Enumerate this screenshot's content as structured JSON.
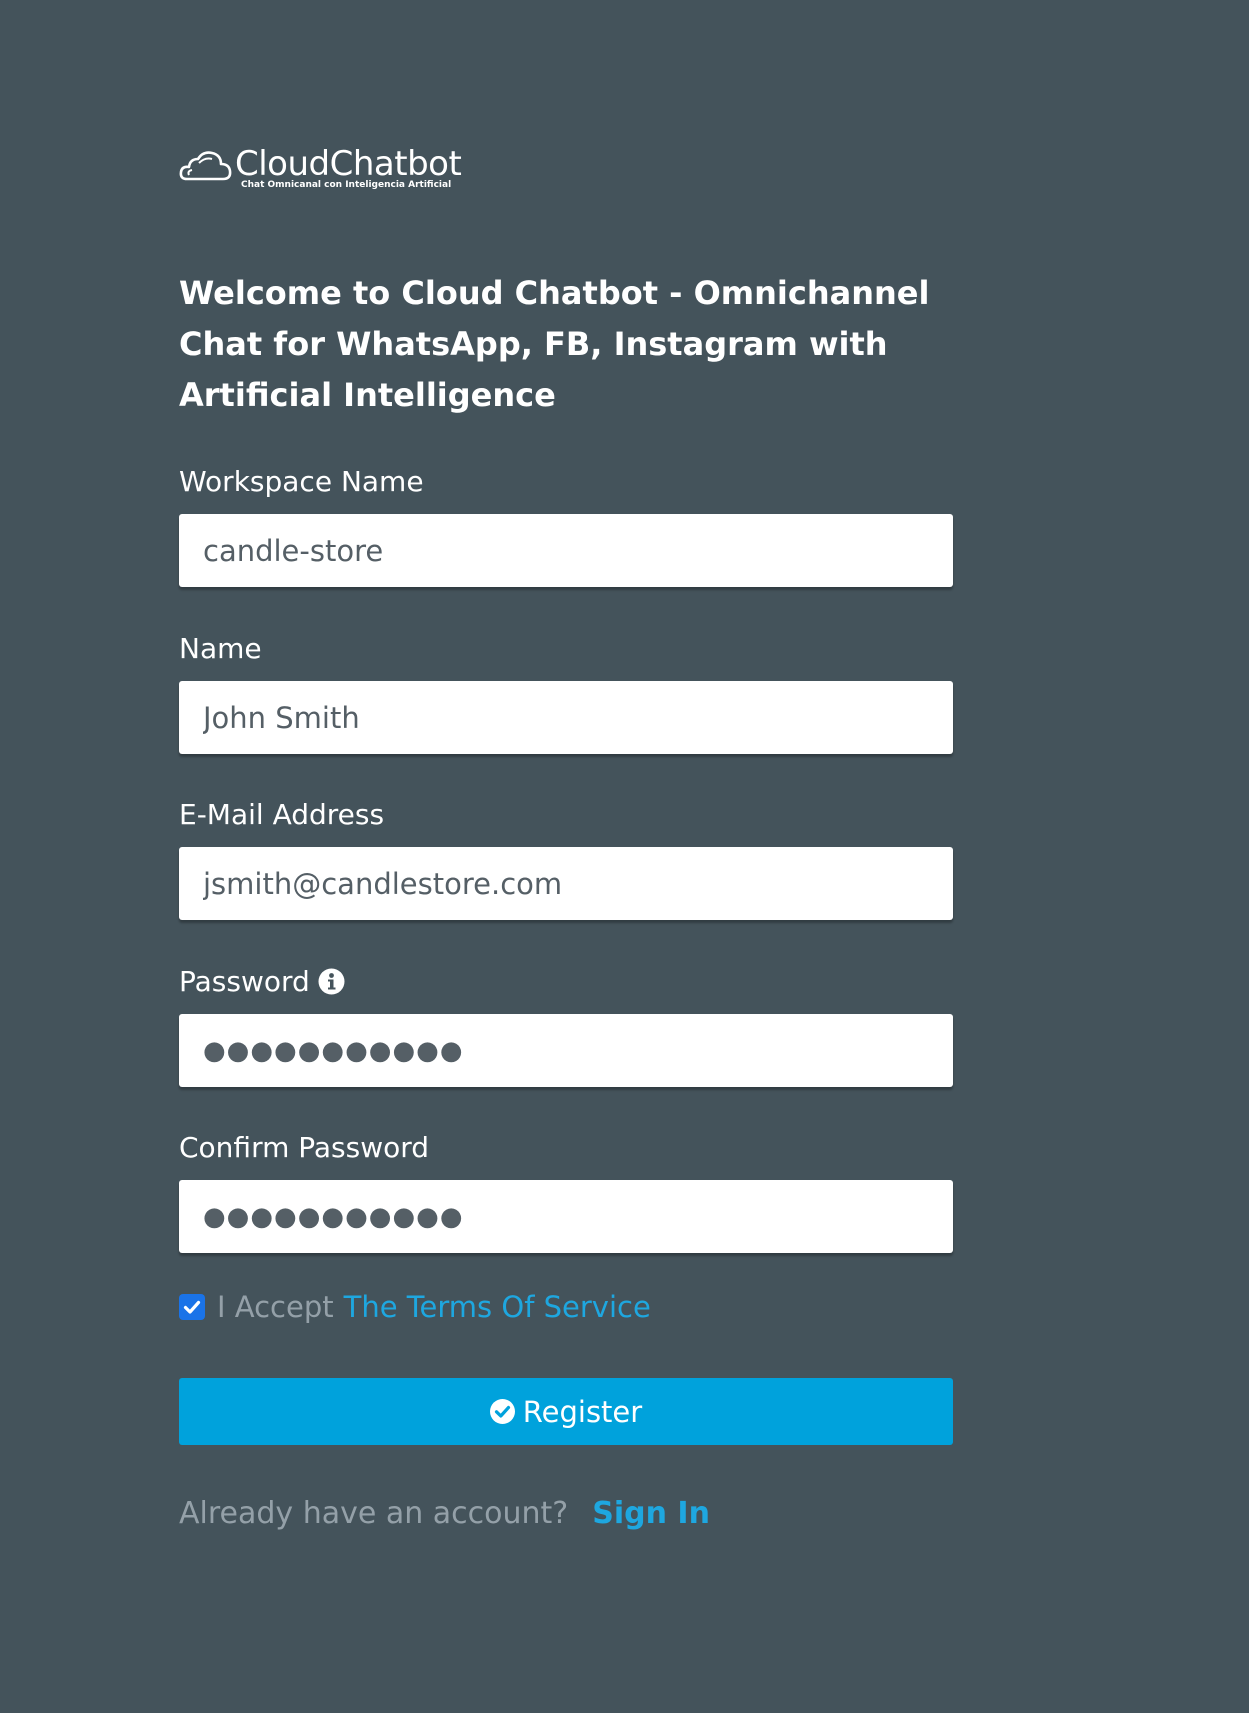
{
  "logo": {
    "name": "CloudChatbot",
    "tagline": "Chat Omnicanal con Inteligencia Artificial"
  },
  "welcome": "Welcome to Cloud Chatbot - Omnichannel Chat for WhatsApp, FB, Instagram with Artificial Intelligence",
  "form": {
    "workspace": {
      "label": "Workspace Name",
      "value": "candle-store"
    },
    "name": {
      "label": "Name",
      "value": "John Smith"
    },
    "email": {
      "label": "E-Mail Address",
      "value": "jsmith@candlestore.com"
    },
    "password": {
      "label": "Password",
      "value": "●●●●●●●●●●●"
    },
    "confirm_password": {
      "label": "Confirm Password",
      "value": "●●●●●●●●●●●"
    },
    "terms": {
      "checked": true,
      "text": "I Accept",
      "link": "The Terms Of Service"
    },
    "register_label": "Register"
  },
  "signin": {
    "text": "Already have an account?",
    "link": "Sign In"
  },
  "colors": {
    "background": "#44535b",
    "accent": "#00a2dc",
    "link": "#1ea7e0",
    "checkbox": "#1a73e8"
  }
}
